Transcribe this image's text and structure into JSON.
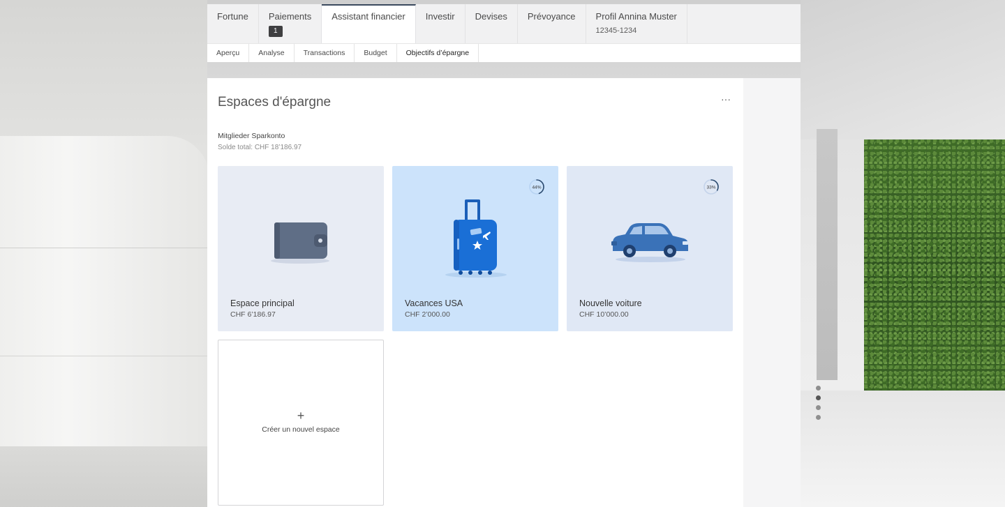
{
  "nav": {
    "tabs": [
      {
        "label": "Fortune"
      },
      {
        "label": "Paiements",
        "badge": "1"
      },
      {
        "label": "Assistant financier",
        "active": true
      },
      {
        "label": "Investir"
      },
      {
        "label": "Devises"
      },
      {
        "label": "Prévoyance"
      },
      {
        "label": "Profil Annina Muster",
        "sub": "12345-1234"
      }
    ]
  },
  "subnav": {
    "items": [
      "Aperçu",
      "Analyse",
      "Transactions",
      "Budget",
      "Objectifs d’épargne"
    ],
    "active_index": 4
  },
  "page": {
    "title": "Espaces d'épargne",
    "more_label": "···",
    "account_name": "Mitglieder Sparkonto",
    "account_total": "Solde total: CHF 18’186.97"
  },
  "cards": [
    {
      "name": "Espace principal",
      "amount": "CHF 6’186.97",
      "icon": "wallet-icon"
    },
    {
      "name": "Vacances USA",
      "amount": "CHF 2’000.00",
      "icon": "suitcase-icon",
      "progress_label": "44%",
      "progress": 0.44
    },
    {
      "name": "Nouvelle voiture",
      "amount": "CHF 10’000.00",
      "icon": "car-icon",
      "progress_label": "33%",
      "progress": 0.33
    }
  ],
  "new_card": {
    "plus": "+",
    "label": "Créer un nouvel espace"
  },
  "pager": {
    "count": 4,
    "active_index": 1
  },
  "colors": {
    "card_main": "#e8ecf4",
    "card_usa": "#cce3fb",
    "card_car": "#e0e8f5",
    "suitcase_blue": "#1a6fd6",
    "car_blue": "#3a72b8",
    "wallet_gray": "#5f6e86"
  }
}
